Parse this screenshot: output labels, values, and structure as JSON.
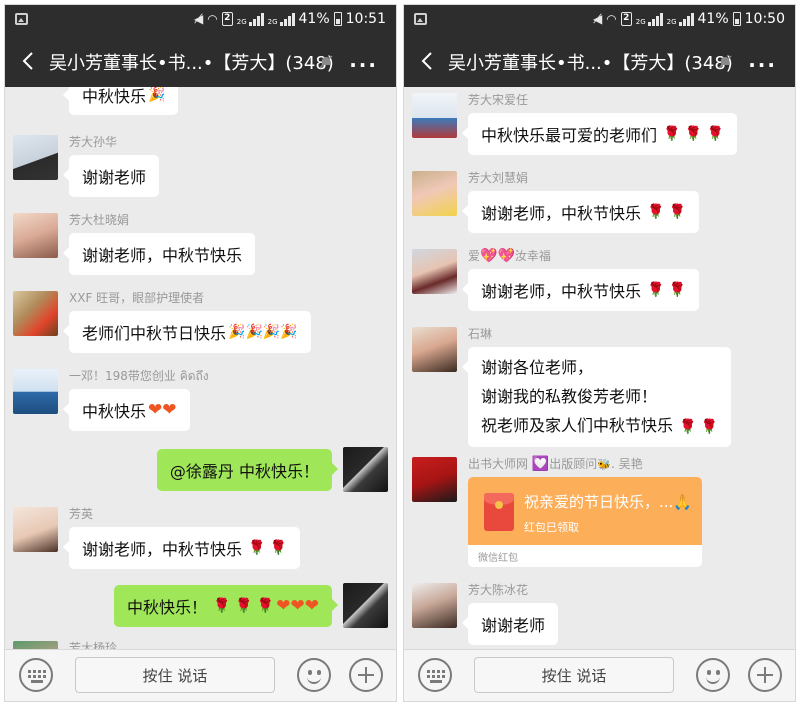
{
  "screens": [
    {
      "statusbar": {
        "battery": "41%",
        "time": "10:51",
        "sim": "2",
        "network": "2G"
      },
      "header": {
        "title": "吴小芳董事长•书...•【芳大】(348)"
      },
      "messages": [
        {
          "text": "中秋快乐"
        },
        {
          "sender": "芳大孙华",
          "text": "谢谢老师"
        },
        {
          "sender": "芳大杜晓娟",
          "text": "谢谢老师，中秋节快乐"
        },
        {
          "sender": "XXF 旺哥，眼部护理使者",
          "text": "老师们中秋节日快乐"
        },
        {
          "sender": "一邓！198带您创业  คิดถึง",
          "text": "中秋快乐"
        },
        {
          "text": "@徐露丹  中秋快乐！"
        },
        {
          "sender": "芳英",
          "text": "谢谢老师，中秋节快乐"
        },
        {
          "text": "中秋快乐！"
        },
        {
          "sender": "芳大杨玲"
        }
      ],
      "bottom": {
        "talk_label": "按住 说话"
      }
    },
    {
      "statusbar": {
        "battery": "41%",
        "time": "10:50",
        "sim": "2",
        "network": "2G"
      },
      "header": {
        "title": "吴小芳董事长•书...•【芳大】(348)"
      },
      "messages": [
        {
          "sender": "芳大宋爱任",
          "text": "中秋快乐最可爱的老师们"
        },
        {
          "sender": "芳大刘慧娟",
          "text": "谢谢老师，中秋节快乐"
        },
        {
          "sender_prefix": "爱",
          "sender_suffix": "汝幸福",
          "text": "谢谢老师，中秋节快乐"
        },
        {
          "sender": "石琳",
          "lines": [
            "谢谢各位老师，",
            "谢谢我的私教俊芳老师！",
            "祝老师及家人们中秋节快乐"
          ]
        },
        {
          "sender_prefix": "出书大师网",
          "sender_middle": "出版顾问",
          "sender_suffix": ". 吴艳",
          "redpacket": {
            "title": "祝亲爱的节日快乐，...",
            "status": "红包已领取",
            "footer": "微信红包"
          }
        },
        {
          "sender": "芳大陈冰花",
          "text": "谢谢老师"
        }
      ],
      "bottom": {
        "talk_label": "按住 说话"
      }
    }
  ],
  "colors": {
    "header_bg": "#2d2d2d",
    "chat_bg": "#ebebeb",
    "own_bubble": "#9fe658",
    "redpacket": "#fcae59"
  },
  "icons": [
    "back-arrow-icon",
    "mute-bell-icon",
    "more-icon",
    "keyboard-icon",
    "emoji-icon",
    "plus-icon",
    "rose-icon",
    "heart-icon",
    "party-popper-icon",
    "pray-icon"
  ]
}
